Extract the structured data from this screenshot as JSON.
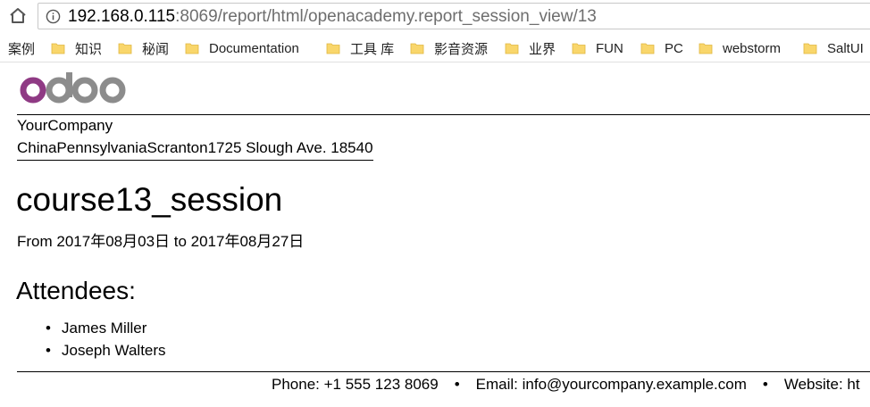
{
  "browser": {
    "url_host": "192.168.0.115",
    "url_rest": ":8069/report/html/openacademy.report_session_view/13",
    "bookmarks": [
      {
        "label": "案例",
        "folder": false
      },
      {
        "label": "知识",
        "folder": true
      },
      {
        "label": "秘闻",
        "folder": true
      },
      {
        "label": "Documentation",
        "folder": true
      },
      {
        "label": "工具 库",
        "folder": true
      },
      {
        "label": "影音资源",
        "folder": true
      },
      {
        "label": "业界",
        "folder": true
      },
      {
        "label": "FUN",
        "folder": true
      },
      {
        "label": "PC",
        "folder": true
      },
      {
        "label": "webstorm",
        "folder": true
      },
      {
        "label": "SaltUI",
        "folder": true
      }
    ]
  },
  "report": {
    "company_name": "YourCompany",
    "company_address": "ChinaPennsylvaniaScranton1725 Slough Ave. 18540",
    "title": "course13_session",
    "dates": "From 2017年08月03日 to 2017年08月27日",
    "attendees_heading": "Attendees:",
    "attendees": [
      "James Miller",
      "Joseph Walters"
    ],
    "footer": {
      "phone": "Phone: +1 555 123 8069",
      "email": "Email: info@yourcompany.example.com",
      "website": "Website: ht",
      "separator": "•"
    }
  },
  "colors": {
    "logo_o": "#8f3a84",
    "logo_doo": "#8c8c8c",
    "folder": "#f9d66b"
  }
}
